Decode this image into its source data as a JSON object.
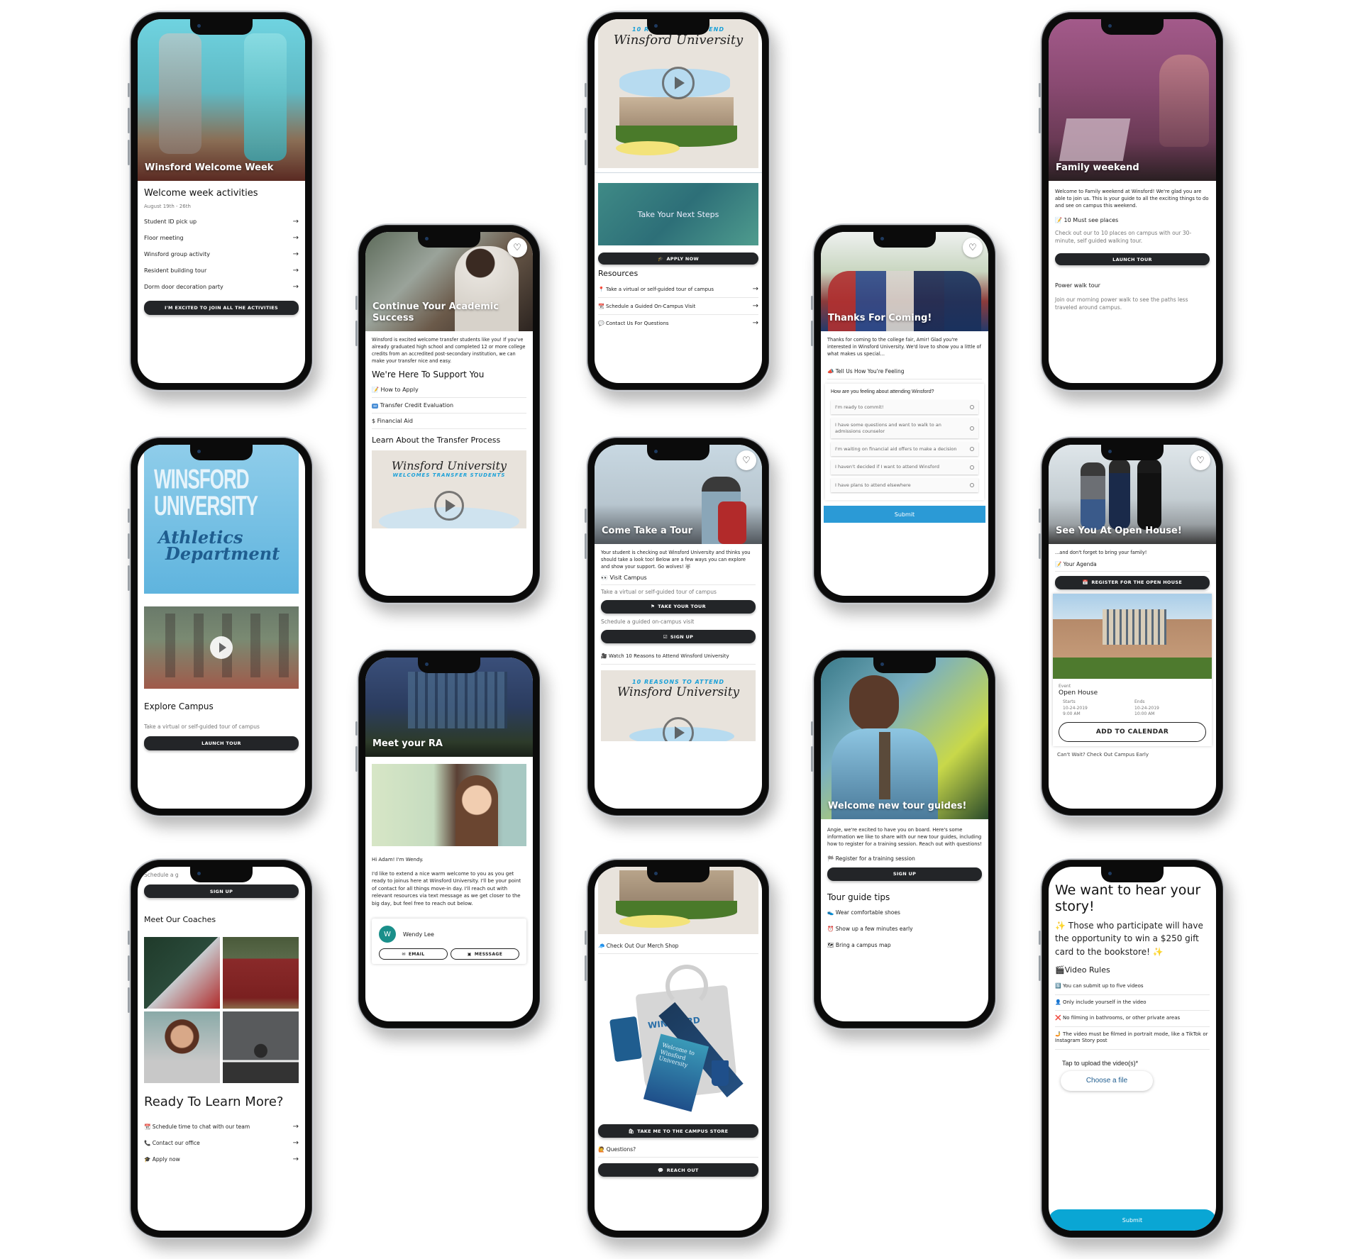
{
  "phones": {
    "welcome_week": {
      "hero_title": "Winsford Welcome Week",
      "heading": "Welcome week activities",
      "date_range": "August 19th - 26th",
      "items": [
        "Student ID pick up",
        "Floor meeting",
        "Winsford group activity",
        "Resident building tour",
        "Dorm door decoration party"
      ],
      "button": "I'M EXCITED TO JOIN ALL THE ACTIVITIES"
    },
    "transfer": {
      "hero_title": "Continue Your Academic Success",
      "intro": "Winsford is excited welcome transfer students like you! If you've already graduated high school and completed 12 or more college credits from an accredited post-secondary institution, we can make your transfer nice and easy.",
      "support_heading": "We're Here To Support You",
      "support_items": [
        {
          "icon": "📝",
          "label": "How to Apply"
        },
        {
          "icon": "↔",
          "label": "Transfer Credit Evaluation"
        },
        {
          "icon": "$",
          "label": "Financial Aid"
        }
      ],
      "learn_heading": "Learn About the Transfer Process",
      "video_script": "Winsford University",
      "video_caption": "WELCOMES TRANSFER STUDENTS"
    },
    "reasons": {
      "video_caption": "10 REASONS TO ATTEND",
      "video_script": "Winsford University",
      "banner_title": "Take Your Next Steps",
      "apply_button": "APPLY NOW",
      "resources_heading": "Resources",
      "resources": [
        {
          "icon": "📍",
          "label": "Take a virtual or self-guided tour of campus"
        },
        {
          "icon": "📆",
          "label": "Schedule a Guided On-Campus Visit"
        },
        {
          "icon": "💬",
          "label": "Contact Us For Questions"
        }
      ]
    },
    "thanks": {
      "hero_title": "Thanks For Coming!",
      "intro": "Thanks for coming to the college fair, Amir! Glad you're interested in Winsford University. We'd love to show you a little of what makes us special...",
      "section_label": "Tell Us How You're Feeling",
      "section_icon": "📣",
      "question": "How are you feeling about attending Winsford?",
      "options": [
        "I'm ready to commit!",
        "I have some questions and want to walk to an admissions counselor",
        "I'm waiting on financial aid offers to make a decision",
        "I haven't decided if I want to attend Winsford",
        "I have plans to attend elsewhere"
      ],
      "submit": "Submit"
    },
    "family": {
      "hero_title": "Family weekend",
      "intro": "Welcome to Family weekend at Winsford! We're glad you are able to join us. This is your guide to all the exciting things to do and see on campus this weekend.",
      "must_see_icon": "📝",
      "must_see": "10 Must see places",
      "must_see_desc": "Check out our to 10 places on campus with our 30-minute, self guided walking tour.",
      "launch_button": "LAUNCH TOUR",
      "power_walk": "Power walk tour",
      "power_walk_desc": "Join our morning power walk to see the paths less traveled around campus."
    },
    "athletics": {
      "banner_line1": "WINSFORD",
      "banner_line2": "UNIVERSITY",
      "banner_script1": "Athletics",
      "banner_script2": "Department",
      "heading": "Explore Campus",
      "desc": "Take a virtual or self-guided tour of campus",
      "button": "LAUNCH TOUR"
    },
    "tour": {
      "hero_title": "Come Take a Tour",
      "intro": "Your student is checking out Winsford University and thinks you should take a look too! Below are a few ways you can explore and show your support. Go wolves! 🐺",
      "visit_icon": "👀",
      "visit_label": "Visit Campus",
      "visit_desc": "Take a virtual or self-guided tour of campus",
      "tour_button": "TAKE YOUR TOUR",
      "schedule_desc": "Schedule a guided on-campus visit",
      "signup_button": "SIGN UP",
      "watch_icon": "🎥",
      "watch_label": "Watch 10 Reasons to Attend Winsford University",
      "video_caption": "10 REASONS TO ATTEND",
      "video_script": "Winsford University"
    },
    "open_house": {
      "hero_title": "See You At Open House!",
      "intro": "...and don't forget to bring your family!",
      "agenda_icon": "📝",
      "agenda": "Your Agenda",
      "register_button": "REGISTER FOR THE OPEN HOUSE",
      "event_label": "Event",
      "event_name": "Open House",
      "starts_label": "Starts",
      "starts_date": "10-24-2019",
      "starts_time": "9:00 AM",
      "ends_label": "Ends",
      "ends_date": "10-24-2019",
      "ends_time": "10:00 AM",
      "calendar_button": "ADD TO CALENDAR",
      "cut_off_text": "Can't Wait? Check Out Campus Early"
    },
    "ra": {
      "hero_title": "Meet your RA",
      "greeting": "Hi Adam! I'm Wendy.",
      "message": "I'd like to extend a nice warm welcome to you as you get ready to joinus here at Winsford University. I'll be your point of contact for all things move-in day. I'll reach out with relevant resources via text message as we get closer to the big day, but feel free to reach out below.",
      "contact_initial": "W",
      "contact_name": "Wendy Lee",
      "email_button": "EMAIL",
      "message_button": "MESSSAGE"
    },
    "tour_guides": {
      "hero_title": "Welcome new tour guides!",
      "intro": "Angie, we're excited to have you on board. Here's some information we like to share with our new tour guides, including how to register for a training session. Reach out with questions!",
      "register_icon": "🏁",
      "register_label": "Register for a training session",
      "signup_button": "SIGN UP",
      "tips_heading": "Tour guide tips",
      "tips": [
        {
          "icon": "👟",
          "label": "Wear comfortable shoes"
        },
        {
          "icon": "⏰",
          "label": "Show up a few minutes early"
        },
        {
          "icon": "🗺",
          "label": "Bring a campus map"
        }
      ]
    },
    "coaches": {
      "cut_off_text": "Schedule a g",
      "signup_button": "SIGN UP",
      "coaches_heading": "Meet Our Coaches",
      "ready_heading": "Ready To Learn More?",
      "links": [
        {
          "icon": "📆",
          "label": "Schedule time to chat with our team"
        },
        {
          "icon": "📞",
          "label": "Contact our office"
        },
        {
          "icon": "🎓",
          "label": "Apply now"
        }
      ]
    },
    "merch": {
      "merch_icon": "🧢",
      "merch_label": "Check Out Our Merch Shop",
      "store_button": "TAKE ME TO THE CAMPUS STORE",
      "questions_icon": "🙋",
      "questions_label": "Questions?",
      "reach_button": "REACH OUT",
      "tote_text": "WINSFORD",
      "book_text": "Welcome to Winsford University"
    },
    "story": {
      "heading": "We want to hear your story!",
      "prize": "✨ Those who participate will have the opportunity to win a $250 gift card to the bookstore! ✨",
      "rules_heading": "🎬Video Rules",
      "rules": [
        {
          "icon": "5️⃣",
          "label": "You can submit up to five videos"
        },
        {
          "icon": "👤",
          "label": "Only include yourself in the video"
        },
        {
          "icon": "❌",
          "label": "No filming in bathrooms, or other private areas"
        },
        {
          "icon": "🤳",
          "label": "The video must be filmed in portrait mode, like a TikTok or Instagram Story post"
        }
      ],
      "upload_label": "Tap to upload the video(s)*",
      "choose_file": "Choose a file",
      "submit": "Submit"
    }
  },
  "colors": {
    "button_dark": "#232528",
    "submit_blue": "#2b9ad6",
    "accent_teal": "#1a8f8a",
    "script_blue": "#1aa0d8"
  }
}
